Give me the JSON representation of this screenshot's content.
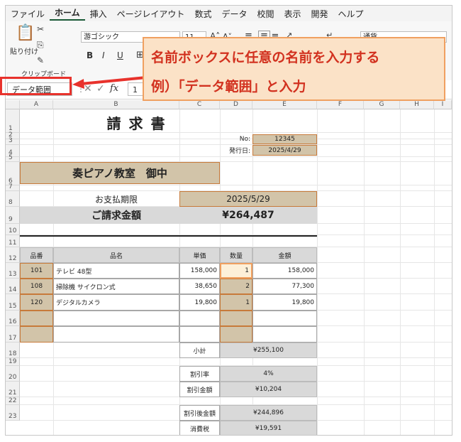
{
  "menu": {
    "items": [
      "ファイル",
      "ホーム",
      "挿入",
      "ページレイアウト",
      "数式",
      "データ",
      "校閲",
      "表示",
      "開発",
      "ヘルプ"
    ],
    "active_index": 1
  },
  "ribbon": {
    "paste_label": "貼り付け",
    "clipboard_group": "クリップボード",
    "font_name": "游ゴシック",
    "font_size": "11",
    "bold": "B",
    "italic": "I",
    "underline": "U",
    "number_format": "通貨"
  },
  "formula_bar": {
    "name_box": "データ範囲",
    "fx": "fx",
    "value": "1"
  },
  "callout": {
    "line1": "名前ボックスに任意の名前を入力する",
    "line2": "例）「データ範囲」と入力"
  },
  "columns": [
    "A",
    "B",
    "C",
    "D",
    "E",
    "F",
    "G",
    "H",
    "I"
  ],
  "rows": [
    "1",
    "2",
    "3",
    "4",
    "5",
    "6",
    "7",
    "8",
    "9",
    "10",
    "11",
    "12",
    "13",
    "14",
    "15",
    "16",
    "17",
    "18",
    "19",
    "20",
    "21",
    "22",
    "23"
  ],
  "invoice": {
    "title": "請 求 書",
    "no_label": "No:",
    "no_value": "12345",
    "issue_label": "発行日:",
    "issue_value": "2025/4/29",
    "customer": "奏ピアノ教室　御中",
    "due_label": "お支払期限",
    "due_value": "2025/5/29",
    "total_label": "ご請求金額",
    "total_value": "¥264,487",
    "headers": {
      "code": "品番",
      "name": "品名",
      "price": "単価",
      "qty": "数量",
      "amount": "金額"
    },
    "items": [
      {
        "code": "101",
        "name": "テレビ 48型",
        "price": "158,000",
        "qty": "1",
        "amount": "158,000"
      },
      {
        "code": "108",
        "name": "掃除機 サイクロン式",
        "price": "38,650",
        "qty": "2",
        "amount": "77,300"
      },
      {
        "code": "120",
        "name": "デジタルカメラ",
        "price": "19,800",
        "qty": "1",
        "amount": "19,800"
      }
    ],
    "subtotal_label": "小計",
    "subtotal_value": "¥255,100",
    "discount_rate_label": "割引率",
    "discount_rate_value": "4%",
    "discount_amount_label": "割引金額",
    "discount_amount_value": "¥10,204",
    "after_discount_label": "割引後金額",
    "after_discount_value": "¥244,896",
    "tax_label": "消費税",
    "tax_value": "¥19,591"
  },
  "colors": {
    "accent_red": "#e8322c",
    "callout_bg": "#fbe2c7",
    "tan_cell": "#d2c4a9",
    "header_gray": "#d9d9d9"
  }
}
